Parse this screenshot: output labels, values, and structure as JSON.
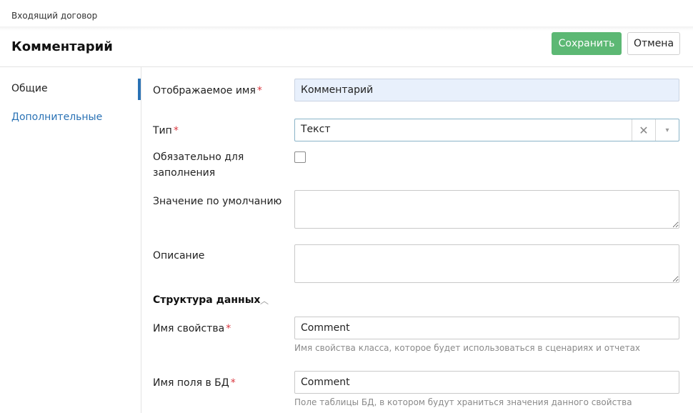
{
  "breadcrumb": "Входящий договор",
  "title": "Комментарий",
  "toolbar": {
    "save_label": "Сохранить",
    "cancel_label": "Отмена"
  },
  "sidebar": {
    "items": [
      {
        "label": "Общие"
      },
      {
        "label": "Дополнительные"
      }
    ]
  },
  "form": {
    "display_name": {
      "label": "Отображаемое имя",
      "required_mark": "*",
      "value": "Комментарий"
    },
    "type": {
      "label": "Тип",
      "required_mark": "*",
      "value": "Текст",
      "clear_glyph": "✕",
      "arrow_glyph": "▾"
    },
    "mandatory": {
      "label": "Обязательно для заполнения",
      "checked": false
    },
    "default_value": {
      "label": "Значение по умолчанию",
      "value": ""
    },
    "description": {
      "label": "Описание",
      "value": ""
    },
    "data_structure": {
      "title": "Структура данных",
      "chevron": "︿",
      "property_name": {
        "label": "Имя свойства",
        "required_mark": "*",
        "value": "Comment",
        "hint": "Имя свойства класса, которое будет использоваться в сценариях и отчетах"
      },
      "db_field_name": {
        "label": "Имя поля в БД",
        "required_mark": "*",
        "value": "Comment",
        "hint": "Поле таблицы БД, в котором будут храниться значения данного свойства"
      }
    }
  },
  "colors": {
    "accent": "#2a72b5",
    "save": "#5cb874",
    "required": "#d9363e",
    "highlight": "#e8f0fc"
  }
}
